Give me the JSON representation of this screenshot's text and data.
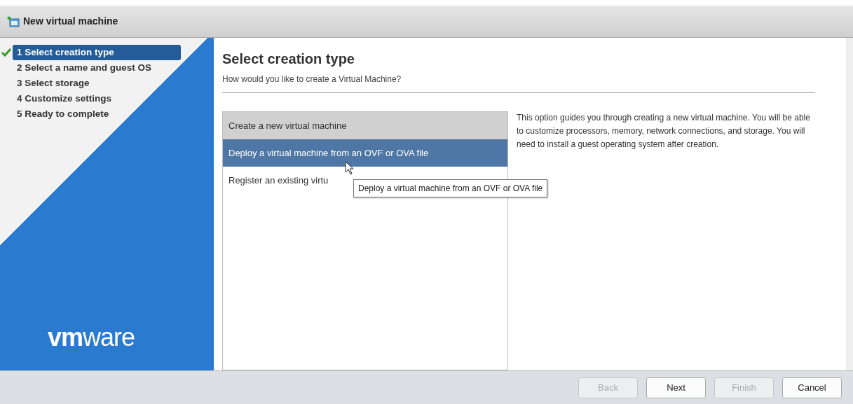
{
  "window": {
    "title": "New virtual machine"
  },
  "steps": [
    {
      "label": "1 Select creation type",
      "selected": true,
      "done": true
    },
    {
      "label": "2 Select a name and guest OS",
      "selected": false,
      "done": false
    },
    {
      "label": "3 Select storage",
      "selected": false,
      "done": false
    },
    {
      "label": "4 Customize settings",
      "selected": false,
      "done": false
    },
    {
      "label": "5 Ready to complete",
      "selected": false,
      "done": false
    }
  ],
  "logo": "**vm**ware",
  "page": {
    "title": "Select creation type",
    "subtitle": "How would you like to create a Virtual Machine?"
  },
  "options": [
    {
      "label": "Create a new virtual machine",
      "selected": true,
      "hovered": false
    },
    {
      "label": "Deploy a virtual machine from an OVF or OVA file",
      "selected": false,
      "hovered": true
    },
    {
      "label": "Register an existing virtu",
      "selected": false,
      "hovered": false
    }
  ],
  "tooltip": "Deploy a virtual machine from an OVF or OVA file",
  "description": "This option guides you through creating a new virtual machine. You will be able to customize processors, memory, network connections, and storage. You will need to install a guest operating system after creation.",
  "buttons": [
    {
      "label": "Back",
      "disabled": true
    },
    {
      "label": "Next",
      "disabled": false
    },
    {
      "label": "Finish",
      "disabled": true
    },
    {
      "label": "Cancel",
      "disabled": false
    }
  ]
}
